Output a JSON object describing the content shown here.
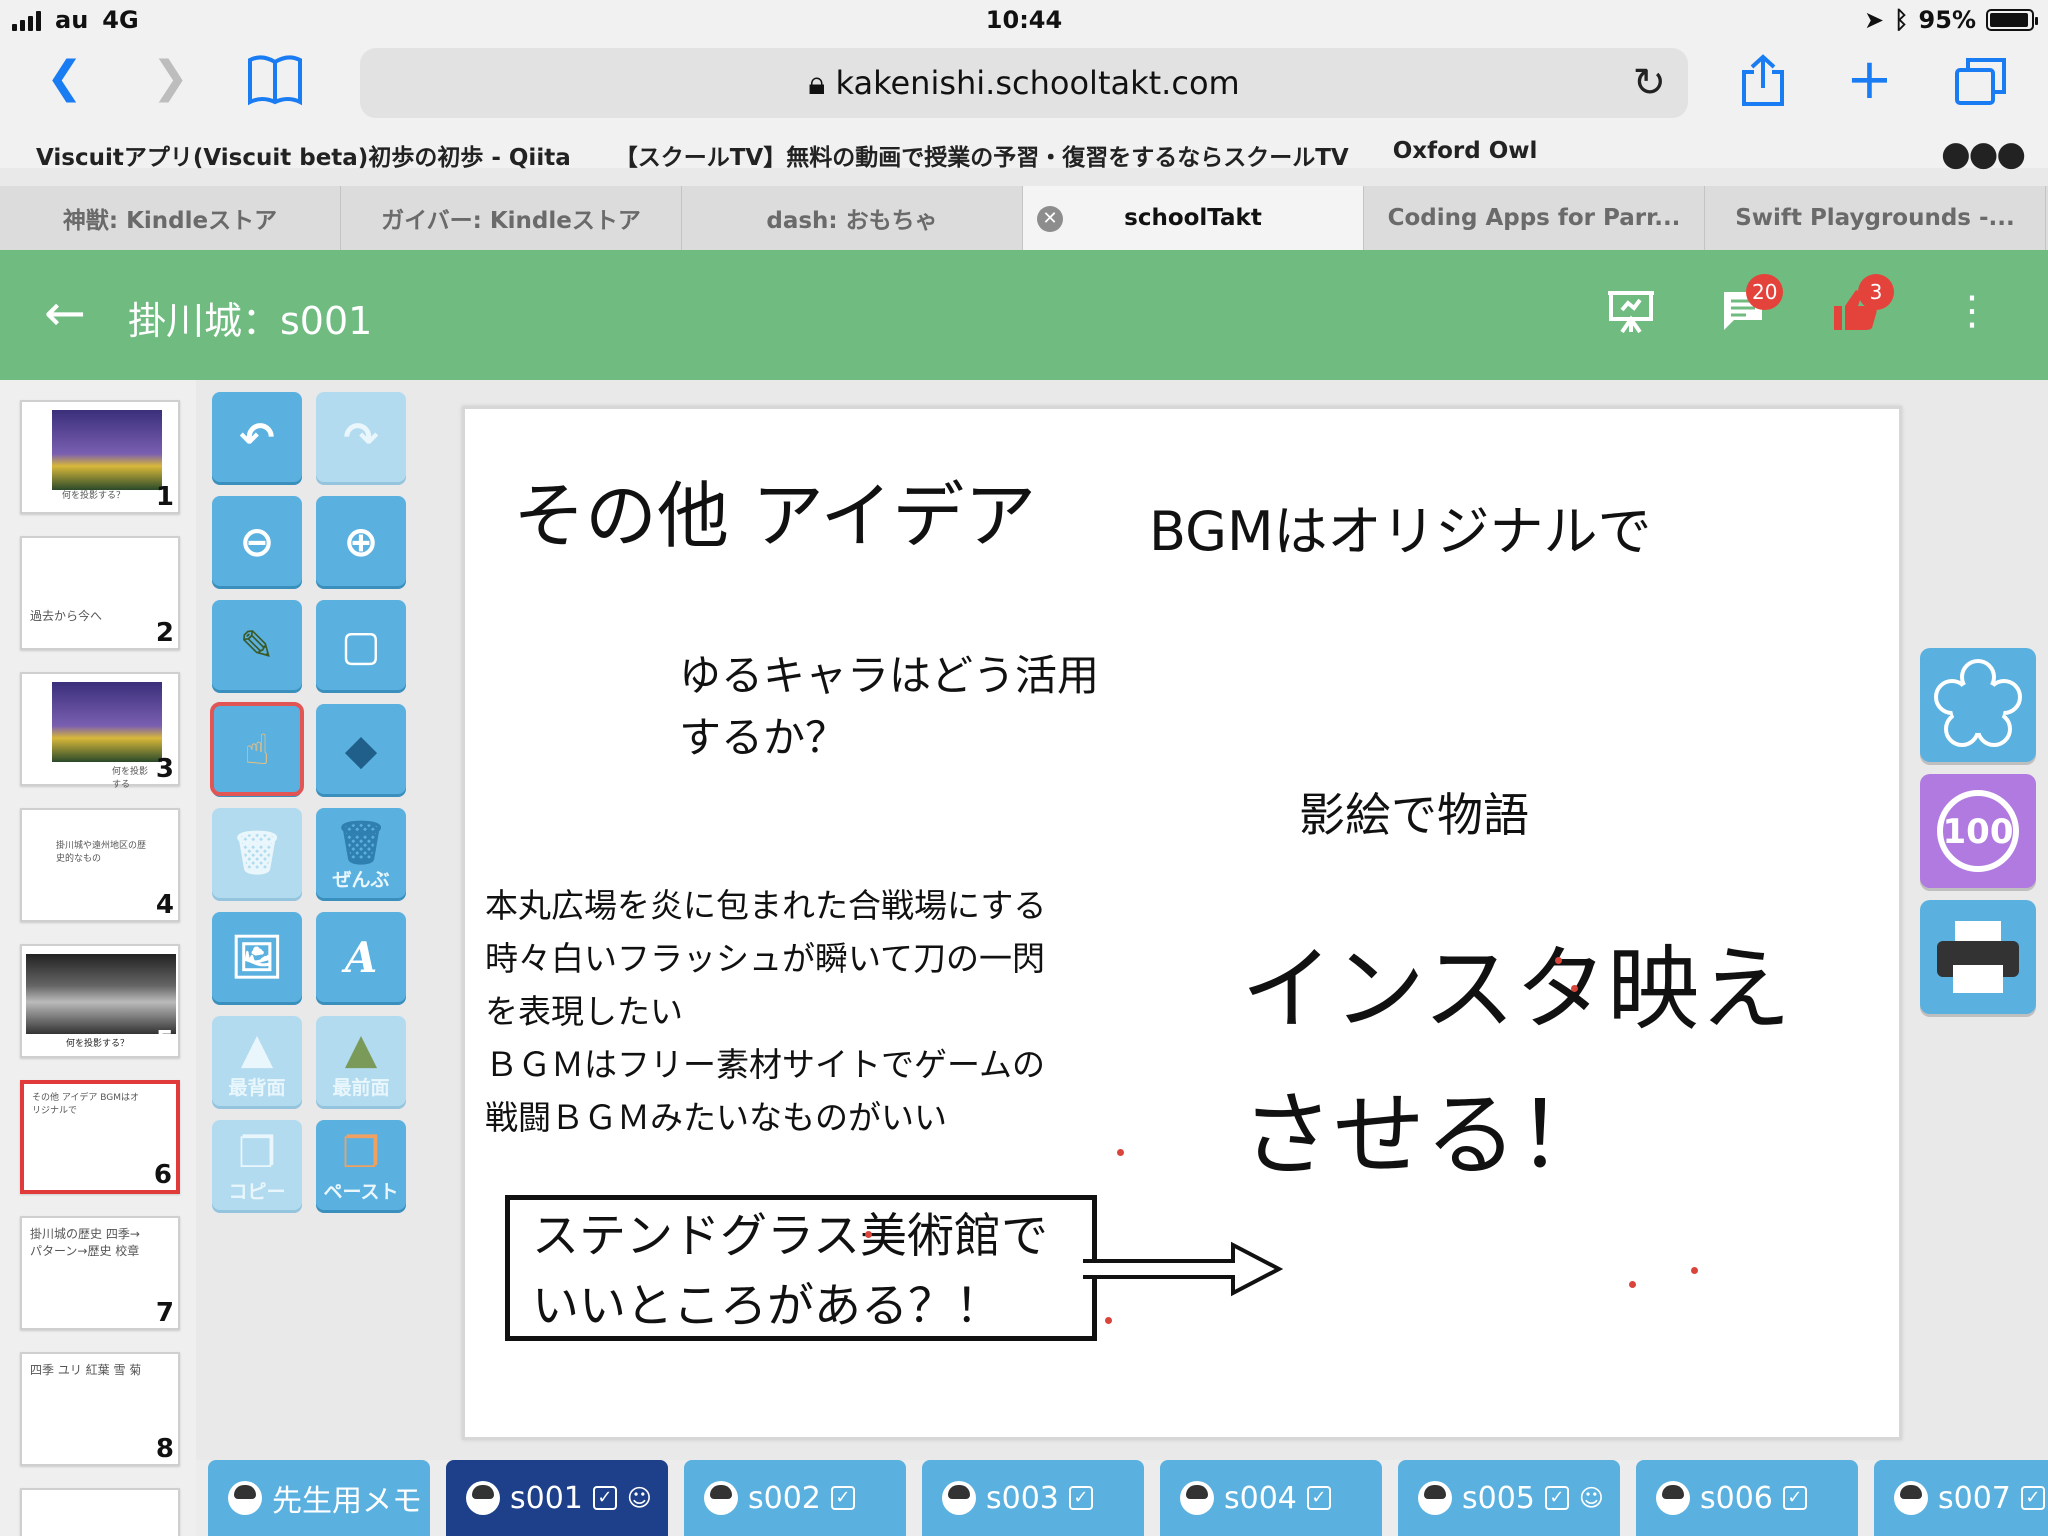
{
  "status": {
    "carrier": "au",
    "network": "4G",
    "time": "10:44",
    "battery": "95%",
    "battery_level": 0.95
  },
  "safari": {
    "url": "kakenishi.schooltakt.com",
    "bookmarks": [
      "Viscuitアプリ(Viscuit beta)初歩の初歩 - Qiita",
      "【スクールTV】無料の動画で授業の予習・復習をするならスクールTV",
      "Oxford Owl"
    ],
    "tabs": [
      {
        "label": "神獣: Kindleストア",
        "active": false
      },
      {
        "label": "ガイバー: Kindleストア",
        "active": false
      },
      {
        "label": "dash: おもちゃ",
        "active": false
      },
      {
        "label": "schoolTakt",
        "active": true
      },
      {
        "label": "Coding Apps for Parr...",
        "active": false
      },
      {
        "label": "Swift Playgrounds -...",
        "active": false
      }
    ]
  },
  "app": {
    "title": "掛川城：s001",
    "comment_count": "20",
    "like_count": "3",
    "accent": "#6fbb80"
  },
  "thumbnails": [
    {
      "num": "1",
      "text": "何を投影する？"
    },
    {
      "num": "2",
      "text": "過去から今へ"
    },
    {
      "num": "3",
      "text": "何を投影する"
    },
    {
      "num": "4",
      "text": "掛川城や遠州地区の歴史的なもの"
    },
    {
      "num": "5",
      "text": "何を投影する？"
    },
    {
      "num": "6",
      "text": "その他 アイデア BGMはオリジナルで"
    },
    {
      "num": "7",
      "text": "掛川城の歴史 四季→パターン→歴史 校章"
    },
    {
      "num": "8",
      "text": "四季 ユリ 紅葉 雪 菊"
    }
  ],
  "tools": {
    "delete_all": "ぜんぶ",
    "send_back": "最背面",
    "bring_front": "最前面",
    "copy": "コピー",
    "paste": "ペースト"
  },
  "canvas": {
    "heading": "その他 アイデア",
    "bgm": "BGMはオリジナルで",
    "yurukyara": "ゆるキャラはどう活用\nするか？",
    "kagee": "影絵で物語",
    "honmaru": "本丸広場を炎に包まれた合戦場にする\n時々白いフラッシュが瞬いて刀の一閃\nを表現したい\nＢＧＭはフリー素材サイトでゲームの\n戦闘ＢＧＭみたいなものがいい",
    "insta": "インスタ映え\nさせる！",
    "stained": "ステンドグラス美術館で\nいいところがある？！"
  },
  "stamps": {
    "score": "100"
  },
  "students": [
    {
      "label": "先生用メモ",
      "active": false
    },
    {
      "label": "s001",
      "active": true
    },
    {
      "label": "s002",
      "active": false
    },
    {
      "label": "s003",
      "active": false
    },
    {
      "label": "s004",
      "active": false
    },
    {
      "label": "s005",
      "active": false
    },
    {
      "label": "s006",
      "active": false
    },
    {
      "label": "s007",
      "active": false
    }
  ]
}
